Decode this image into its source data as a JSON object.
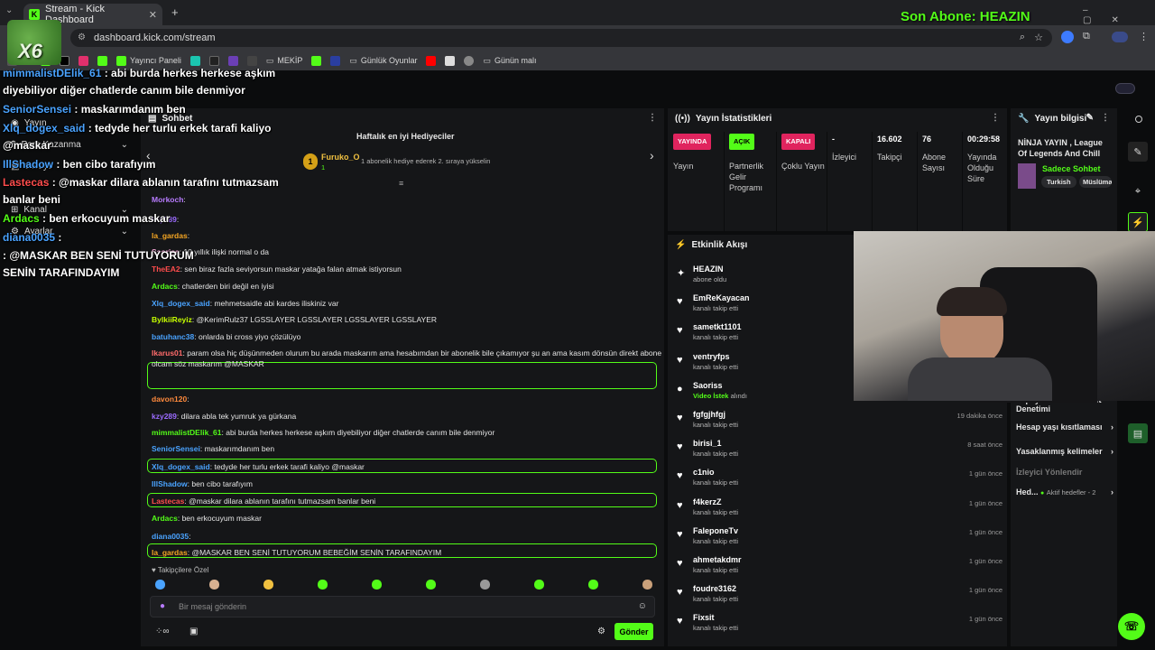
{
  "browser": {
    "tab_title": "Stream - Kick Dashboard",
    "url": "dashboard.kick.com/stream",
    "bookmarks": [
      "Yayıncı Paneli",
      "MEKİP",
      "Günlük Oyunlar",
      "Günün malı"
    ]
  },
  "overlay_top": {
    "sub_label": "Son Abone: HEAZIN"
  },
  "sidebar": {
    "items": [
      "Yayın",
      "Para Kazanma",
      "Studyo",
      "Kanal",
      "Ayarlar"
    ]
  },
  "chat": {
    "title": "Sohbet",
    "gifter_header": "Haftalık en iyi Hediyeciler",
    "gifter_name": "Furuko_O",
    "gifter_rank": "1",
    "gifter_count": "1",
    "gifter_tip": "1 abonelik hediye ederek 2. sıraya yükselin",
    "messages": [
      {
        "user": "Morkoch",
        "text": "",
        "color": "#b77bff"
      },
      {
        "user": "kzy289",
        "text": "",
        "color": "#9b6bff"
      },
      {
        "user": "la_gardas",
        "text": "",
        "color": "#f5a623"
      },
      {
        "user": "Saoriss",
        "text": "10 yıllık ilişki normal o da",
        "color": "#f5a6d6"
      },
      {
        "user": "TheEA2",
        "text": "sen biraz fazla seviyorsun maskar yatağa falan atmak istiyorsun",
        "color": "#ff4d4d"
      },
      {
        "user": "Ardacs",
        "text": "chatlerden biri değil en iyisi",
        "color": "#53fc18"
      },
      {
        "user": "Xlq_dogex_said",
        "text": "mehmetsaidle abi kardes iliskiniz var",
        "color": "#4aa3ff"
      },
      {
        "user": "BylkiiReyiz",
        "text": "@KerimRulz37 LGSSLAYER LGSSLAYER LGSSLAYER LGSSLAYER",
        "color": "#c6ff00"
      },
      {
        "user": "batuhanc38",
        "text": "onlarda bi cross yiyo çözülüyo",
        "color": "#4aa3ff"
      },
      {
        "user": "Ikarus01",
        "text": "param olsa hiç düşünmeden olurum bu arada maskarım ama hesabımdan bir abonelik bile çıkamıyor şu an ama kasım dönsün direkt abone",
        "text2": "olcam söz maskarım @MASKAR",
        "color": "#ff6b6b"
      },
      {
        "user": "davon120",
        "text": "",
        "color": "#ff8a3d"
      },
      {
        "user": "kzy289",
        "text": "dilara abla tek yumruk ya gürkana",
        "color": "#9b6bff"
      },
      {
        "user": "mimmalistDElik_61",
        "text": "abi burda herkes herkese aşkım diyebiliyor diğer chatlerde canım bile denmiyor",
        "color": "#53fc18"
      },
      {
        "user": "SeniorSensei",
        "text": "maskarımdanım ben",
        "color": "#4aa3ff"
      },
      {
        "user": "Xlq_dogex_said",
        "text": "tedyde her turlu erkek tarafi kaliyo @maskar",
        "color": "#4aa3ff"
      },
      {
        "user": "IllShadow",
        "text": "ben cibo tarafıyım",
        "color": "#4aa3ff"
      },
      {
        "user": "Lastecas",
        "text": "@maskar dilara ablanın tarafını tutmazsam banlar beni",
        "color": "#ff4d4d"
      },
      {
        "user": "Ardacs",
        "text": "ben erkocuyum maskar",
        "color": "#53fc18"
      },
      {
        "user": "diana0035",
        "text": "",
        "color": "#4aa3ff"
      },
      {
        "user": "la_gardas",
        "text": "@MASKAR BEN SENİ TUTUYORUM BEBEĞİM SENİN TARAFINDAYIM",
        "color": "#f5a623"
      }
    ],
    "followers_only": "Takipçilere Özel",
    "input_placeholder": "Bir mesaj gönderin",
    "send_label": "Gönder"
  },
  "stats": {
    "title": "Yayın İstatistikleri",
    "cols": [
      {
        "badge": "YAYINDA",
        "label": "Yayın",
        "badge_color": "#e0245e"
      },
      {
        "badge": "AÇIK",
        "label": "Partnerlik Gelir Programı",
        "badge_color": "#53fc18"
      },
      {
        "badge": "KAPALI",
        "label": "Çoklu Yayın",
        "badge_color": "#e0245e"
      },
      {
        "value": "-",
        "label": "İzleyici"
      },
      {
        "value": "16.602",
        "label": "Takipçi"
      },
      {
        "value": "76",
        "label": "Abone Sayısı"
      },
      {
        "value": "00:29:58",
        "label": "Yayında Olduğu Süre"
      }
    ]
  },
  "feed": {
    "title": "Etkinlik Akışı",
    "events": [
      {
        "name": "HEAZIN",
        "sub": "abone oldu",
        "time": "",
        "icon": "star"
      },
      {
        "name": "EmReKayacan",
        "sub": "kanalı takip etti",
        "time": "",
        "icon": "heart"
      },
      {
        "name": "sametkt1101",
        "sub": "kanalı takip etti",
        "time": "",
        "icon": "heart"
      },
      {
        "name": "ventryfps",
        "sub": "kanalı takip etti",
        "time": "",
        "icon": "heart"
      },
      {
        "name": "Saoriss",
        "sub": "Video İstek",
        "sub2": "alındı",
        "time": "",
        "icon": "video"
      },
      {
        "name": "fgfgjhfgj",
        "sub": "kanalı takip etti",
        "time": "19 dakika önce",
        "icon": "heart"
      },
      {
        "name": "birisi_1",
        "sub": "kanalı takip etti",
        "time": "8 saat önce",
        "icon": "heart"
      },
      {
        "name": "c1nio",
        "sub": "kanalı takip etti",
        "time": "1 gün önce",
        "icon": "heart"
      },
      {
        "name": "f4kerzZ",
        "sub": "kanalı takip etti",
        "time": "1 gün önce",
        "icon": "heart"
      },
      {
        "name": "FaleponeTv",
        "sub": "kanalı takip etti",
        "time": "1 gün önce",
        "icon": "heart"
      },
      {
        "name": "ahmetakdmr",
        "sub": "kanalı takip etti",
        "time": "1 gün önce",
        "icon": "heart"
      },
      {
        "name": "foudre3162",
        "sub": "kanalı takip etti",
        "time": "1 gün önce",
        "icon": "heart"
      },
      {
        "name": "Fixsit",
        "sub": "kanalı takip etti",
        "time": "1 gün önce",
        "icon": "heart"
      }
    ]
  },
  "info": {
    "title": "Yayın bilgisi",
    "stream_title": "NİNJA YAYIN , League Of Legends And Chill",
    "category": "Sadece Sohbet",
    "tags": [
      "Turkish",
      "Müslüman"
    ],
    "links": [
      "Yapay Zeka ile Sohbet Denetimi",
      "Hesap yaşı kısıtlaması",
      "Yasaklanmış kelimeler",
      "İzleyici Yönlendir"
    ],
    "goals_label": "Hed...",
    "goals_value": "Aktif hedefler - 2"
  },
  "overlay_chat": [
    {
      "user": "mimmalistDElik_61",
      "text": " : abi burda herkes herkese aşkım",
      "color": "#4aa3ff"
    },
    {
      "user": "",
      "text": "diyebiliyor diğer chatlerde canım bile denmiyor",
      "color": "#fff"
    },
    {
      "user": "SeniorSensei",
      "text": " : maskarımdanım ben",
      "color": "#4aa3ff"
    },
    {
      "user": "Xlq_dogex_said",
      "text": " : tedyde her turlu erkek tarafi kaliyo",
      "color": "#4aa3ff"
    },
    {
      "user": "",
      "text": "@maskar",
      "color": "#fff"
    },
    {
      "user": "IllShadow",
      "text": " : ben cibo tarafıyım",
      "color": "#4aa3ff"
    },
    {
      "user": "Lastecas",
      "text": " : @maskar dilara ablanın tarafını tutmazsam",
      "color": "#ff4d4d"
    },
    {
      "user": "",
      "text": "banlar beni",
      "color": "#fff"
    },
    {
      "user": "Ardacs",
      "text": " : ben erkocuyum maskar",
      "color": "#53fc18"
    },
    {
      "user": "diana0035",
      "text": " :",
      "color": "#4aa3ff"
    },
    {
      "user": "",
      "text": ": @MASKAR BEN SENİ TUTUYORUM",
      "color": "#fff"
    },
    {
      "user": "",
      "text": "SENİN TARAFINDAYIM",
      "color": "#fff"
    }
  ],
  "logo": "X6"
}
